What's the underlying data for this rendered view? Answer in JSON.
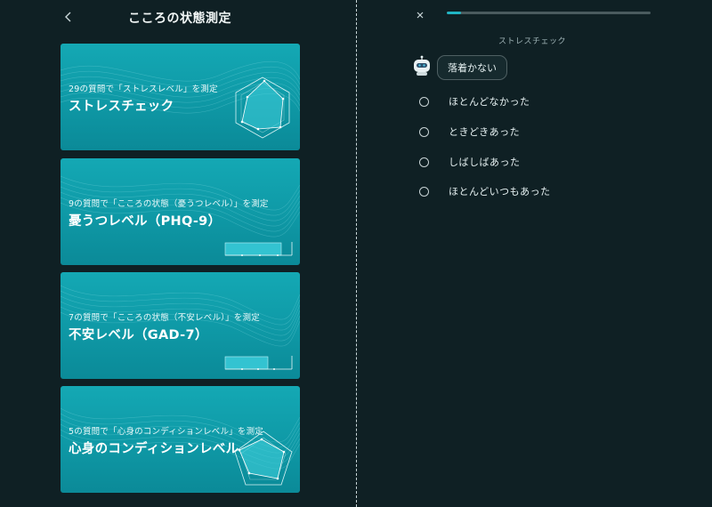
{
  "left": {
    "title": "こころの状態測定",
    "cards": [
      {
        "subtitle": "29の質問で「ストレスレベル」を測定",
        "title": "ストレスチェック",
        "deco": "hexagon-radar"
      },
      {
        "subtitle": "9の質問で「こころの状態（憂うつレベル）」を測定",
        "title": "憂うつレベル（PHQ-9）",
        "deco": "bar-gauge"
      },
      {
        "subtitle": "7の質問で「こころの状態（不安レベル）」を測定",
        "title": "不安レベル（GAD-7）",
        "deco": "bar-gauge"
      },
      {
        "subtitle": "5の質問で「心身のコンディションレベル」を測定",
        "title": "心身のコンディションレベル",
        "deco": "pentagon-radar"
      }
    ]
  },
  "right": {
    "progress": 0.07,
    "section_label": "ストレスチェック",
    "question": "落着かない",
    "options": [
      "ほとんどなかった",
      "ときどきあった",
      "しばしばあった",
      "ほとんどいつもあった"
    ]
  },
  "icons": {
    "back": "chevron-left-icon",
    "close": "close-icon",
    "bot": "robot-icon"
  },
  "colors": {
    "background": "#0f2024",
    "card": "#14a8b4",
    "accent": "#20b5c4"
  }
}
